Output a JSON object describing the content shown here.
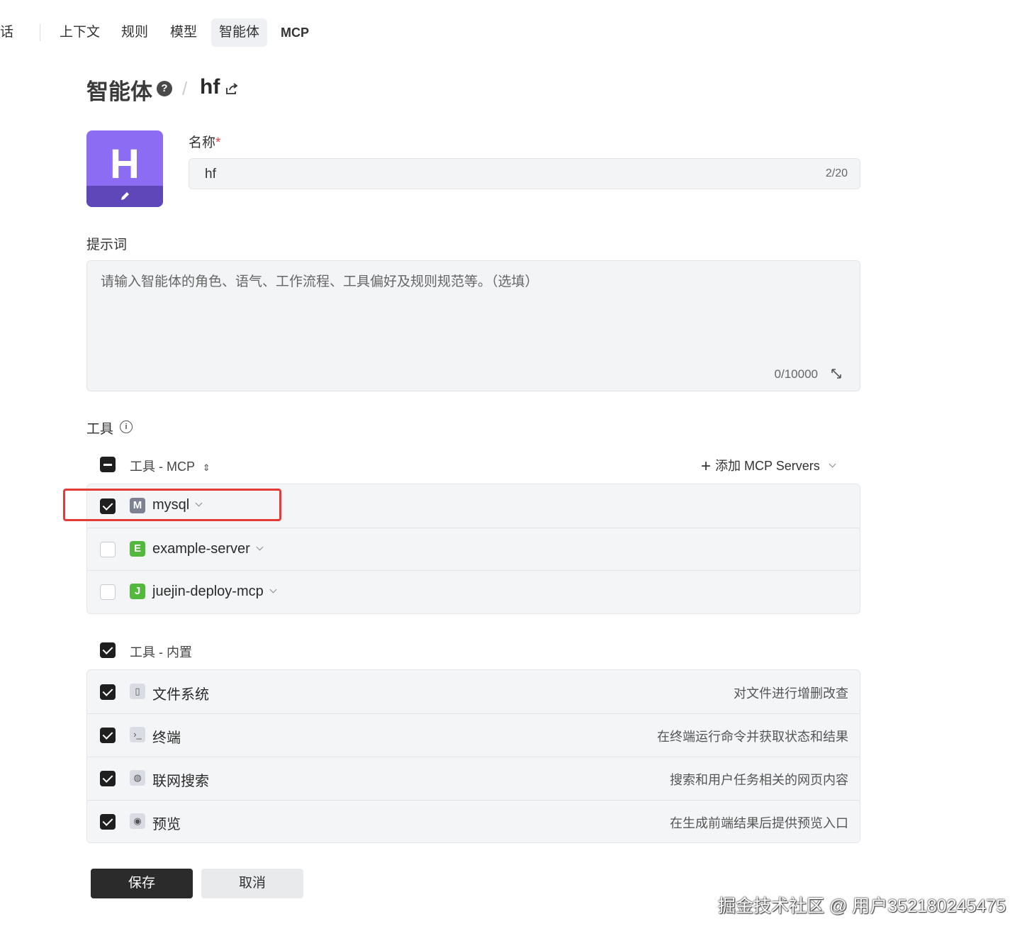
{
  "nav": {
    "partial_item": "话",
    "items": [
      "上下文",
      "规则",
      "模型",
      "智能体",
      "MCP"
    ],
    "active": "智能体"
  },
  "header": {
    "title": "智能体",
    "help_icon": "?",
    "separator": "/",
    "agent_name": "hf"
  },
  "avatar": {
    "letter": "H",
    "color": "#8b6cf2"
  },
  "name_field": {
    "label": "名称",
    "required_mark": "*",
    "value": "hf",
    "counter": "2/20"
  },
  "prompt_field": {
    "label": "提示词",
    "placeholder": "请输入智能体的角色、语气、工作流程、工具偏好及规则规范等。（选填）",
    "counter": "0/10000"
  },
  "tools": {
    "label": "工具",
    "mcp_group": {
      "label": "工具 - MCP",
      "add_button": "添加 MCP Servers",
      "servers": [
        {
          "letter": "M",
          "name": "mysql",
          "checked": true,
          "color": "#7d8191"
        },
        {
          "letter": "E",
          "name": "example-server",
          "checked": false,
          "color": "#52b93c"
        },
        {
          "letter": "J",
          "name": "juejin-deploy-mcp",
          "checked": false,
          "color": "#52b93c"
        }
      ]
    },
    "builtin_group": {
      "label": "工具 - 内置",
      "items": [
        {
          "icon": "file-icon",
          "name": "文件系统",
          "desc": "对文件进行增删改查",
          "checked": true
        },
        {
          "icon": "terminal-icon",
          "name": "终端",
          "desc": "在终端运行命令并获取状态和结果",
          "checked": true
        },
        {
          "icon": "globe-icon",
          "name": "联网搜索",
          "desc": "搜索和用户任务相关的网页内容",
          "checked": true
        },
        {
          "icon": "eye-icon",
          "name": "预览",
          "desc": "在生成前端结果后提供预览入口",
          "checked": true
        }
      ]
    }
  },
  "actions": {
    "save": "保存",
    "cancel": "取消"
  },
  "watermark": "掘金技术社区 @ 用户352180245475"
}
